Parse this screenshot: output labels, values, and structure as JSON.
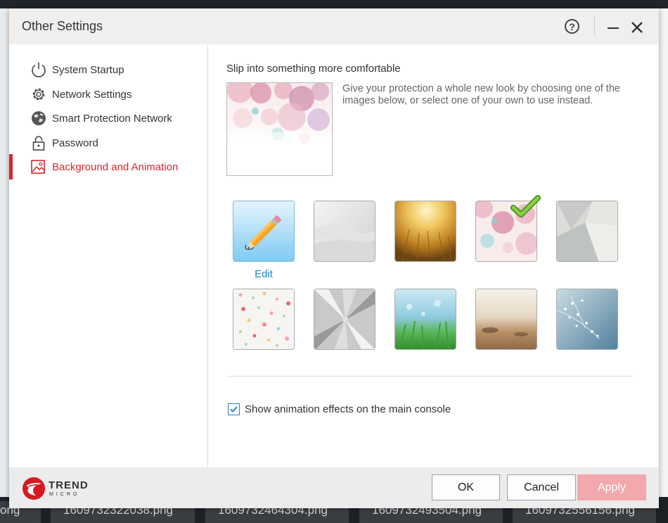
{
  "window": {
    "title": "Other Settings"
  },
  "sidebar": {
    "items": [
      {
        "label": "System Startup",
        "icon": "power-icon"
      },
      {
        "label": "Network Settings",
        "icon": "gear-icon"
      },
      {
        "label": "Smart Protection Network",
        "icon": "globe-icon"
      },
      {
        "label": "Password",
        "icon": "lock-icon"
      },
      {
        "label": "Background and Animation",
        "icon": "image-icon",
        "active": true
      }
    ]
  },
  "content": {
    "section_title": "Slip into something more comfortable",
    "description": "Give your protection a whole new look by choosing one of the images below, or select one of your own to use instead.",
    "edit_label": "Edit",
    "selected_background": "pink-bubbles",
    "backgrounds": [
      "edit",
      "silver-waves",
      "golden-wheat",
      "pink-bubbles",
      "geometric-gray",
      "confetti-dots",
      "brushed-metal",
      "green-grass",
      "sandy-beach",
      "blue-blossoms"
    ],
    "animation_checkbox": {
      "label": "Show animation effects on the main console",
      "checked": true
    }
  },
  "footer": {
    "brand": "TREND",
    "brand_sub": "MICRO",
    "ok_label": "OK",
    "cancel_label": "Cancel",
    "apply_label": "Apply"
  },
  "taskbar": {
    "thumbs": [
      "ong",
      "1609732322038.png",
      "1609732464304.png",
      "1609732493504.png",
      "1609732556156.png"
    ]
  },
  "colors": {
    "accent": "#d7262e",
    "link": "#1b86c9",
    "apply_disabled": "#f2a8ac"
  }
}
